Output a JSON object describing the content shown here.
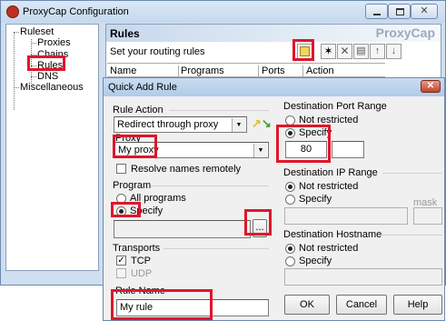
{
  "app": {
    "title": "ProxyCap Configuration",
    "brand": "ProxyCap"
  },
  "tree": {
    "items": [
      {
        "label": "Ruleset"
      },
      {
        "label": "Proxies"
      },
      {
        "label": "Chains"
      },
      {
        "label": "Rules"
      },
      {
        "label": "DNS"
      },
      {
        "label": "Miscellaneous"
      }
    ]
  },
  "rules": {
    "header": "Rules",
    "subtitle": "Set your routing rules",
    "columns": [
      "Name",
      "Programs",
      "Ports",
      "Action"
    ]
  },
  "dialog": {
    "title": "Quick Add Rule",
    "rule_action": {
      "label": "Rule Action",
      "value": "Redirect through proxy"
    },
    "proxy": {
      "label": "Proxy",
      "value": "My proxy"
    },
    "resolve_remotely": {
      "label": "Resolve names remotely",
      "checked": false
    },
    "program": {
      "label": "Program",
      "all": "All programs",
      "specify": "Specify",
      "path": "",
      "browse": "..."
    },
    "transports": {
      "label": "Transports",
      "tcp": "TCP",
      "udp": "UDP",
      "tcp_checked": true,
      "udp_checked": false
    },
    "rule_name": {
      "label": "Rule Name",
      "value": "My rule"
    },
    "dest_port": {
      "label": "Destination Port Range",
      "not_restricted": "Not restricted",
      "specify": "Specify",
      "from": "80",
      "to": ""
    },
    "dest_ip": {
      "label": "Destination IP Range",
      "not_restricted": "Not restricted",
      "specify": "Specify",
      "ip": "",
      "mask_label": "mask",
      "mask": ""
    },
    "dest_host": {
      "label": "Destination Hostname",
      "not_restricted": "Not restricted",
      "specify": "Specify",
      "host": ""
    },
    "buttons": {
      "ok": "OK",
      "cancel": "Cancel",
      "help": "Help"
    }
  },
  "colors": {
    "highlight": "#e0162b",
    "title_bar": "#d5e3f2",
    "dialog_title": "#b9d1ea"
  }
}
